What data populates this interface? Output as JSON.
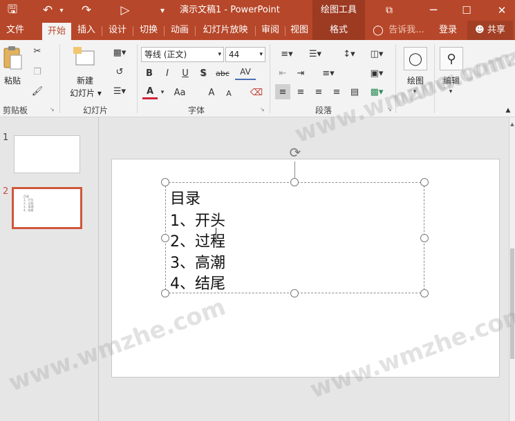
{
  "window": {
    "title": "演示文稿1 - PowerPoint",
    "context_title": "绘图工具"
  },
  "quick_access": {
    "save_icon": "🖫",
    "undo_icon": "↶",
    "redo_icon": "↷",
    "slideshow_icon": "▷",
    "customize_icon": "▾"
  },
  "window_controls": {
    "ribbon_options_icon": "⧉",
    "minimize": "─",
    "maximize": "☐",
    "close": "✕"
  },
  "tabs": [
    "文件",
    "开始",
    "插入",
    "设计",
    "切换",
    "动画",
    "幻灯片放映",
    "审阅",
    "视图",
    "格式"
  ],
  "active_tab": "开始",
  "tell_me": "告诉我...",
  "sign_in": "登录",
  "share": "共享",
  "ribbon": {
    "clipboard": {
      "paste": "粘贴",
      "group": "剪贴板"
    },
    "slides": {
      "new_slide": "新建",
      "new_slide2": "幻灯片",
      "group": "幻灯片"
    },
    "font": {
      "font_name": "等线 (正文)",
      "font_size": "44",
      "bold": "B",
      "italic": "I",
      "underline": "U",
      "shadow": "S",
      "strike": "abc",
      "spacing": "AV",
      "color": "A",
      "case": "Aa",
      "grow": "A",
      "shrink": "A",
      "group": "字体"
    },
    "paragraph": {
      "group": "段落"
    },
    "drawing": {
      "label": "绘图"
    },
    "editing": {
      "label": "编辑"
    }
  },
  "thumbnails": [
    {
      "num": "1"
    },
    {
      "num": "2",
      "lines": [
        "目录",
        "1、开头",
        "2、过程",
        "3、高潮",
        "4、结尾"
      ]
    }
  ],
  "slide": {
    "lines": [
      "目录",
      "1、开头",
      "2、过程",
      "3、高潮",
      "4、结尾"
    ]
  },
  "watermark": "www.wmzhe.com",
  "colors": {
    "accent": "#b7472a",
    "selected_thumb_border": "#d0573a"
  }
}
